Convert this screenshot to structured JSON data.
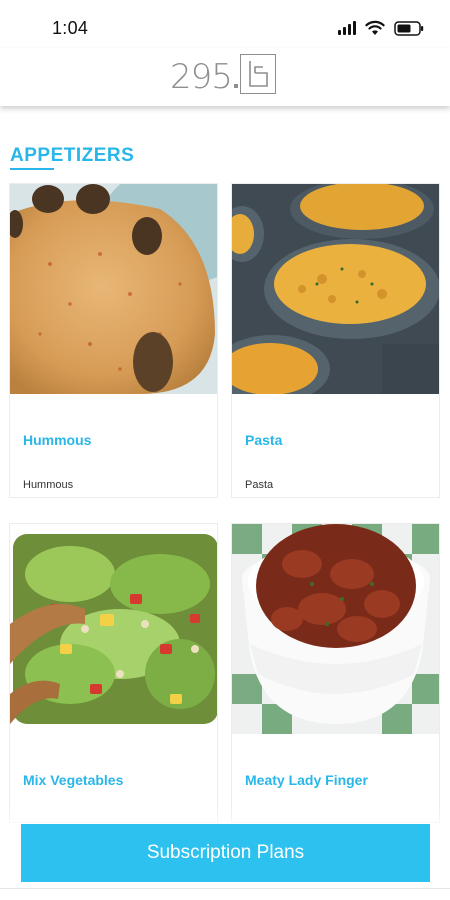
{
  "status_bar": {
    "time": "1:04",
    "icons": [
      "signal-icon",
      "wifi-icon",
      "battery-icon"
    ]
  },
  "header": {
    "logo_text": "295",
    "logo_box_letter": "B"
  },
  "section": {
    "title": "APPETIZERS"
  },
  "items": [
    {
      "title": "Hummous",
      "subtitle": "Hummous",
      "image": "hummous-photo"
    },
    {
      "title": "Pasta",
      "subtitle": "Pasta",
      "image": "pasta-photo"
    },
    {
      "title": "Mix Vegetables",
      "subtitle": "",
      "image": "mix-vegetables-photo"
    },
    {
      "title": "Meaty Lady Finger",
      "subtitle": "",
      "image": "meaty-lady-finger-photo"
    }
  ],
  "footer": {
    "subscribe_label": "Subscription Plans"
  },
  "colors": {
    "accent": "#29b6e8",
    "button": "#2dc1ef",
    "logo_gray": "#8e8e8e"
  }
}
